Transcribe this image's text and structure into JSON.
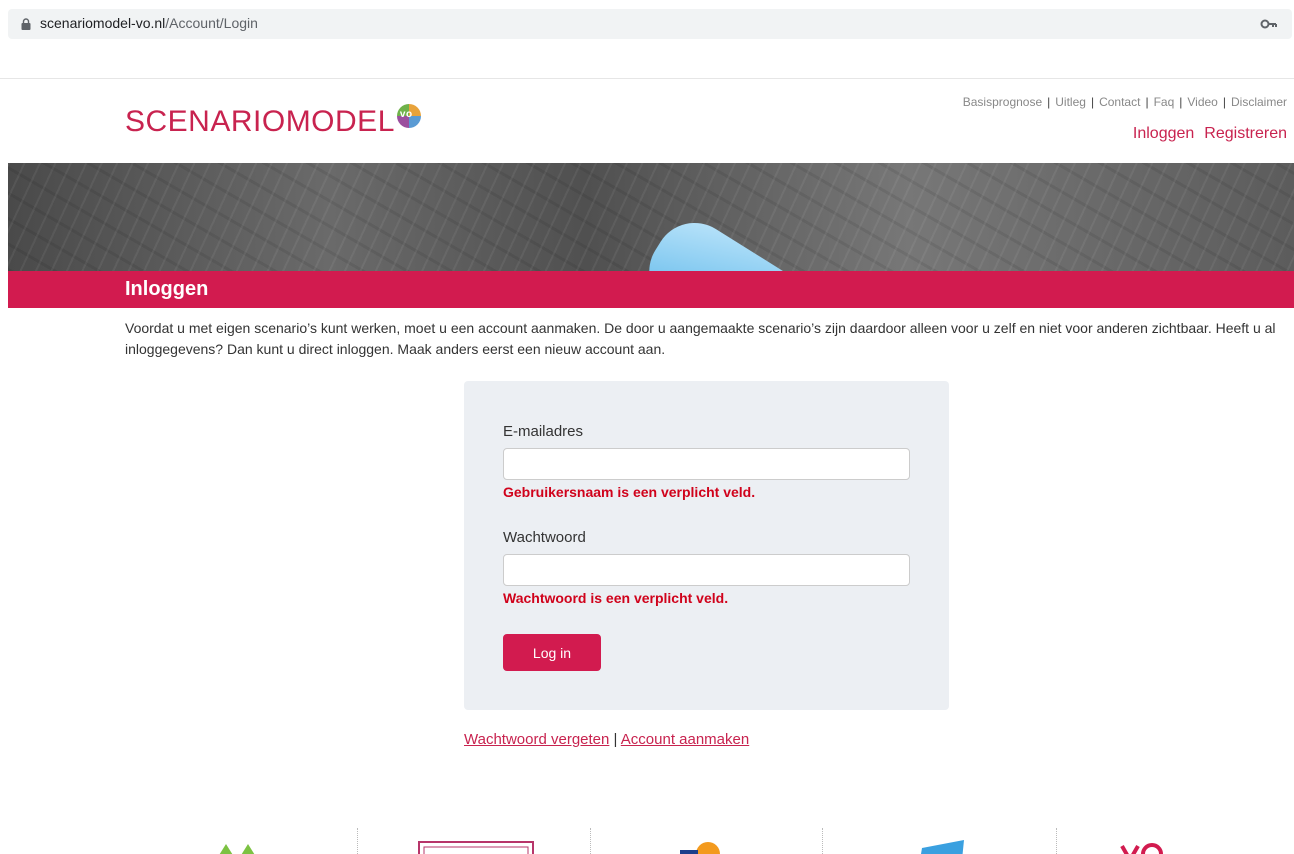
{
  "browser": {
    "url_host": "scenariomodel-vo.nl",
    "url_path": "/Account/Login"
  },
  "header": {
    "logo_text": "SCENARIOMODEL",
    "logo_badge": "vo",
    "top_nav": [
      "Basisprognose",
      "Uitleg",
      "Contact",
      "Faq",
      "Video",
      "Disclaimer"
    ],
    "login_link": "Inloggen",
    "register_link": "Registreren"
  },
  "page": {
    "title": "Inloggen",
    "intro": "Voordat u met eigen scenario’s kunt werken, moet u een account aanmaken. De door u aangemaakte scenario’s zijn daardoor alleen voor u zelf en niet voor anderen zichtbaar. Heeft u al inloggegevens? Dan kunt u direct inloggen. Maak anders eerst een nieuw account aan."
  },
  "form": {
    "email_label": "E-mailadres",
    "email_value": "",
    "email_error": "Gebruikersnaam is een verplicht veld.",
    "password_label": "Wachtwoord",
    "password_value": "",
    "password_error": "Wachtwoord is een verplicht veld.",
    "submit_label": "Log in"
  },
  "links": {
    "forgot": "Wachtwoord vergeten",
    "separator": "|",
    "create": "Account aanmaken"
  },
  "colors": {
    "brand": "#d21b4f",
    "error": "#d0021b"
  }
}
